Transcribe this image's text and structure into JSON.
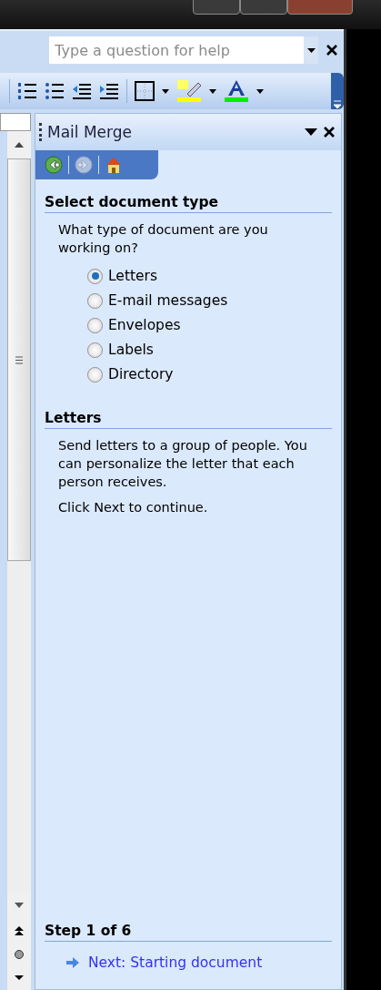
{
  "help_box": {
    "placeholder": "Type a question for help"
  },
  "task_pane": {
    "title": "Mail Merge",
    "nav": [
      {
        "kind": "back",
        "disabled": false
      },
      {
        "kind": "forward",
        "disabled": true
      },
      {
        "kind": "home",
        "disabled": false
      }
    ],
    "sections": [
      {
        "heading": "Select document type",
        "paragraphs": [
          "What type of document are you working on?"
        ],
        "options": [
          {
            "label": "Letters",
            "selected": true
          },
          {
            "label": "E-mail messages",
            "selected": false
          },
          {
            "label": "Envelopes",
            "selected": false
          },
          {
            "label": "Labels",
            "selected": false
          },
          {
            "label": "Directory",
            "selected": false
          }
        ]
      },
      {
        "heading": "Letters",
        "paragraphs": [
          "Send letters to a group of people. You can personalize the letter that each person receives.",
          "Click Next to continue."
        ]
      }
    ],
    "footer": {
      "heading": "Step 1 of 6",
      "link": "Next: Starting document"
    }
  }
}
